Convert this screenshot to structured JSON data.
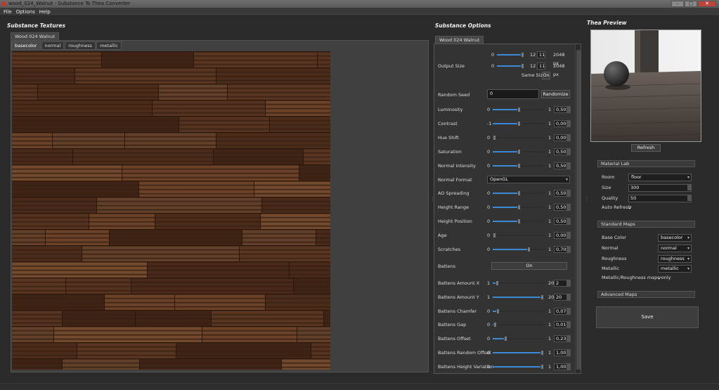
{
  "window": {
    "title": "wood_024_Walnut - Substance To Thea Converter",
    "min": "–",
    "max": "□",
    "close": "✕"
  },
  "menu": [
    "File",
    "Options",
    "Help"
  ],
  "textures": {
    "heading": "Substance Textures",
    "material_tab": "Wood 024 Walnut",
    "map_tabs": [
      "basecolor",
      "normal",
      "roughness",
      "metallic"
    ]
  },
  "options": {
    "heading": "Substance Options",
    "material_tab": "Wood 024 Walnut",
    "output_size": {
      "label": "Output Size",
      "min": "0",
      "val": "12",
      "max": "11",
      "unit": "2048 px",
      "same_size": "Same Size:",
      "same_size_val": "On"
    },
    "random_seed": {
      "label": "Random Seed",
      "value": "0",
      "button": "Randomize"
    },
    "rows": [
      {
        "label": "Luminosity",
        "min": "0",
        "max": "1",
        "value": "0,50",
        "fill": 0.5
      },
      {
        "label": "Contrast",
        "min": "-1",
        "max": "1",
        "value": "0,00",
        "fill": 0.5
      },
      {
        "label": "Hue Shift",
        "min": "0",
        "max": "1",
        "value": "0,00",
        "fill": 0.0
      },
      {
        "label": "Saturation",
        "min": "0",
        "max": "1",
        "value": "0,50",
        "fill": 0.5
      },
      {
        "label": "Normal Intensity",
        "min": "0",
        "max": "1",
        "value": "0,50",
        "fill": 0.5
      }
    ],
    "normal_format": {
      "label": "Normal Format",
      "value": "OpenGL"
    },
    "rows2": [
      {
        "label": "AO Spreading",
        "min": "0",
        "max": "1",
        "value": "0,50",
        "fill": 0.5
      },
      {
        "label": "Height Range",
        "min": "0",
        "max": "1",
        "value": "0,50",
        "fill": 0.5
      },
      {
        "label": "Height Position",
        "min": "0",
        "max": "1",
        "value": "0,50",
        "fill": 0.5
      },
      {
        "label": "Age",
        "min": "0",
        "max": "1",
        "value": "0,00",
        "fill": 0.0
      },
      {
        "label": "Scratches",
        "min": "0",
        "max": "1",
        "value": "0,70",
        "fill": 0.7
      }
    ],
    "battens": {
      "label": "Battens",
      "value": "On"
    },
    "rows3": [
      {
        "label": "Battens Amount X",
        "min": "1",
        "max": "20",
        "value": "2",
        "fill": 0.05
      },
      {
        "label": "Battens Amount Y",
        "min": "1",
        "max": "20",
        "value": "20",
        "fill": 1.0
      },
      {
        "label": "Battens Chamfer",
        "min": "0",
        "max": "1",
        "value": "0,07",
        "fill": 0.07
      },
      {
        "label": "Battens Gap",
        "min": "0",
        "max": "1",
        "value": "0,01",
        "fill": 0.01
      },
      {
        "label": "Battens Offset",
        "min": "0",
        "max": "1",
        "value": "0,23",
        "fill": 0.23
      },
      {
        "label": "Battens Random Offset",
        "min": "0",
        "max": "1",
        "value": "1,00",
        "fill": 1.0
      },
      {
        "label": "Battens Height Variation",
        "min": "0",
        "max": "1",
        "value": "1,00",
        "fill": 1.0
      }
    ]
  },
  "preview": {
    "heading": "Thea Preview",
    "refresh": "Refresh",
    "material_lab": "Material Lab",
    "room_label": "Room",
    "room_value": "floor",
    "size_label": "Size",
    "size_value": "300",
    "quality_label": "Quality",
    "quality_value": "50",
    "auto_refresh_label": "Auto Refresh",
    "auto_refresh_check": "✓",
    "standard_maps": "Standard Maps",
    "base_color_label": "Base Color",
    "base_color_value": "basecolor",
    "normal_label": "Normal",
    "normal_value": "normal",
    "roughness_label": "Roughness",
    "roughness_value": "roughness",
    "metallic_label": "Metallic",
    "metallic_value": "metallic",
    "mr_only_label": "Metallic/Roughness maps only",
    "mr_only_check": "✓",
    "advanced_maps": "Advanced Maps",
    "save": "Save"
  }
}
